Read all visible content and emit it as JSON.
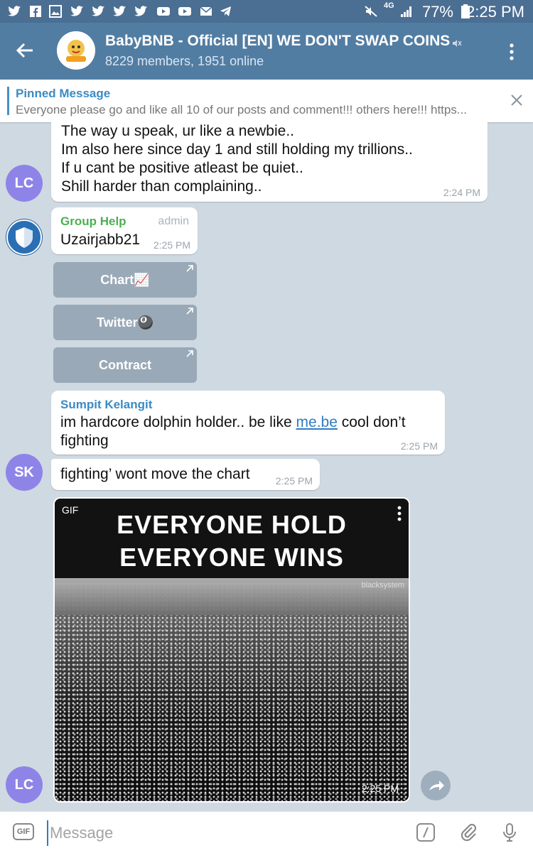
{
  "status_bar": {
    "battery": "77%",
    "time": "2:25 PM",
    "network": "4G"
  },
  "header": {
    "title": "BabyBNB - Official [EN] WE DON'T SWAP COINS",
    "subtitle": "8229 members, 1951 online",
    "avatar_icon": "babybnb-logo"
  },
  "pinned": {
    "title": "Pinned Message",
    "text": "Everyone please go and like all 10 of our posts and comment!!!   others here!!!  https..."
  },
  "messages": {
    "m1": {
      "avatar": "LC",
      "text": "The way u speak, ur like a newbie..\nIm also here since day 1 and still holding my trillions..\nIf u cant be positive atleast be quiet..\nShill harder than complaining..",
      "time": "2:24 PM"
    },
    "m2": {
      "sender": "Group Help",
      "role": "admin",
      "text": "Uzairjabb21",
      "time": "2:25 PM",
      "buttons": [
        "Chart📈",
        "Twitter🎱",
        "Contract"
      ]
    },
    "m3": {
      "sender": "Sumpit Kelangit",
      "text_before": "im hardcore dolphin holder.. be like ",
      "link": "me.be",
      "text_after": " cool don’t\nfighting",
      "time": "2:25 PM"
    },
    "m4": {
      "avatar": "SK",
      "text": "fighting’ wont move the chart",
      "time": "2:25 PM"
    },
    "m5": {
      "avatar": "LC",
      "gif_label": "GIF",
      "caption_line1": "EVERYONE HOLD",
      "caption_line2": "EVERYONE WINS",
      "watermark": "blacksystem",
      "time": "2:25 PM"
    }
  },
  "input": {
    "placeholder": "Message",
    "gif_button": "GIF"
  },
  "colors": {
    "header": "#527da3",
    "status_bar": "#4b6e93",
    "avatar_lc": "#8e84e8",
    "sender_group_help": "#4caf50",
    "sender_sumpit": "#3b8ac4",
    "link": "#2f7bc4"
  }
}
